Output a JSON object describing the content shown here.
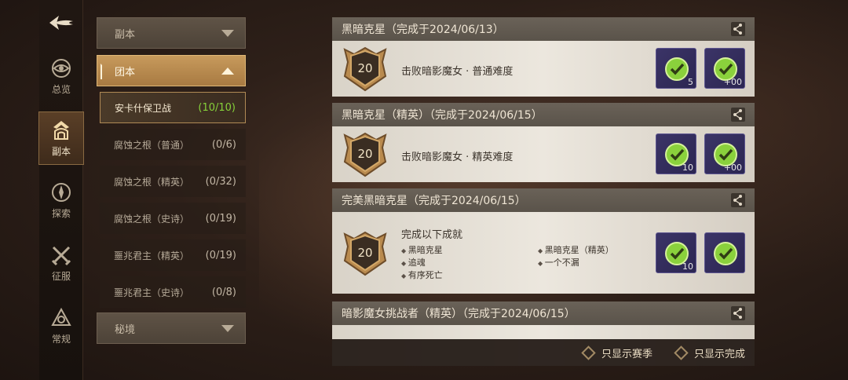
{
  "nav": {
    "items": [
      {
        "label": "总览",
        "icon": "eye-icon"
      },
      {
        "label": "副本",
        "icon": "dungeon-icon"
      },
      {
        "label": "探索",
        "icon": "compass-icon"
      },
      {
        "label": "征服",
        "icon": "crossed-swords-icon"
      },
      {
        "label": "常规",
        "icon": "triangle-emblem-icon"
      }
    ],
    "active": "副本"
  },
  "categories": {
    "top": "副本",
    "open": "团本",
    "bottom": "秘境",
    "sub_items": [
      {
        "name": "安卡什保卫战",
        "count": "(10/10)"
      },
      {
        "name": "腐蚀之根（普通）",
        "count": "(0/6)"
      },
      {
        "name": "腐蚀之根（精英）",
        "count": "(0/32)"
      },
      {
        "name": "腐蚀之根（史诗）",
        "count": "(0/19)"
      },
      {
        "name": "噩兆君主（精英）",
        "count": "(0/19)"
      },
      {
        "name": "噩兆君主（史诗）",
        "count": "(0/8)"
      }
    ]
  },
  "achievements": [
    {
      "title": "黑暗克星（完成于2024/06/13）",
      "points": "20",
      "desc": "击败暗影魔女 · 普通难度",
      "rewards": [
        "5",
        "+00"
      ]
    },
    {
      "title": "黑暗克星（精英）（完成于2024/06/15）",
      "points": "20",
      "desc": "击败暗影魔女 · 精英难度",
      "rewards": [
        "10",
        "+00"
      ]
    },
    {
      "title": "完美黑暗克星（完成于2024/06/15）",
      "points": "20",
      "desc": "完成以下成就",
      "list": [
        "黑暗克星",
        "黑暗克星（精英）",
        "追魂",
        "一个不漏",
        "有序死亡"
      ],
      "rewards": [
        "10",
        ""
      ]
    },
    {
      "title": "暗影魔女挑战者（精英）（完成于2024/06/15）"
    }
  ],
  "filters": {
    "season": "只显示赛季",
    "completed": "只显示完成"
  },
  "colors": {
    "accent": "#c79a5c",
    "reward_bg": "#2c2652",
    "check_green": "#8ad13c",
    "selected_count": "#86d13a"
  }
}
